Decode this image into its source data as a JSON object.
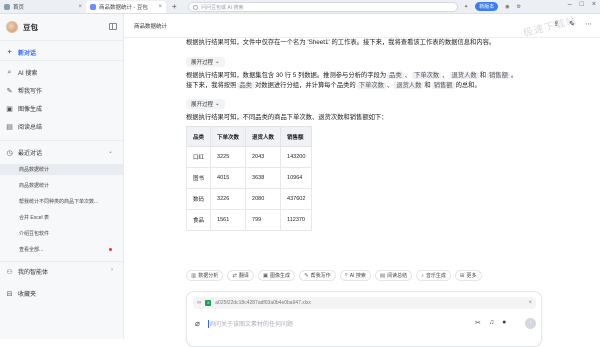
{
  "browser": {
    "tabs": [
      {
        "label": "首页",
        "icon": "home-icon"
      },
      {
        "label": "商品数据统计 - 豆包",
        "icon": "doubao-icon"
      }
    ],
    "address_placeholder": "问问豆包或 AI 搜索",
    "sys_pill": "新版本"
  },
  "sidebar": {
    "brand": "豆包",
    "items": [
      {
        "label": "新对话",
        "icon": "plus-icon"
      },
      {
        "label": "AI 搜索",
        "icon": "search-icon"
      },
      {
        "label": "帮我写作",
        "icon": "pen-icon"
      },
      {
        "label": "图像生成",
        "icon": "image-icon"
      },
      {
        "label": "阅读总结",
        "icon": "book-icon"
      }
    ],
    "recent_header": "最近对话",
    "recent": [
      "商品数据统计",
      "商品数据统计",
      "帮我统计不同种类的商品下单次数...",
      "合并 Excel 表",
      "介绍豆包软件",
      "查看全部..."
    ],
    "agents": "我的智能体",
    "favorites": "收藏夹"
  },
  "main": {
    "title": "商品数据统计",
    "watermark": "极速下载站",
    "p1": "根据执行结果可知，文件中仅存在一个名为 'Sheet1' 的工作表。接下来，我将查看该工作表的数据信息和内容。",
    "expand": "展开过程",
    "p2a": "根据执行结果可知，数据集包含 30 行 5 列数据。推测参与分析的字段为",
    "p2tags": [
      "品类",
      "下单次数",
      "退货人数",
      "销售额"
    ],
    "p2end": "。",
    "p3a": "接下来，我将按照",
    "p3tag": "品类",
    "p3b": "对数据进行分组，并计算每个品类的",
    "p3tags": [
      "下单次数",
      "退货人数",
      "销售额"
    ],
    "p3c": "的总和。",
    "expand2": "展开过程",
    "p4": "根据执行结果可知，不同品类的商品下单次数、退货次数和销售额如下：",
    "table": {
      "headers": [
        "品类",
        "下单次数",
        "退货人数",
        "销售额"
      ],
      "rows": [
        [
          "口红",
          "3225",
          "2043",
          "143200"
        ],
        [
          "图书",
          "4015",
          "3638",
          "10964"
        ],
        [
          "数码",
          "3226",
          "2080",
          "437602"
        ],
        [
          "食品",
          "1561",
          "799",
          "112370"
        ]
      ]
    },
    "tools": [
      {
        "label": "数据分析",
        "icon": "chart-icon"
      },
      {
        "label": "翻译",
        "icon": "translate-icon"
      },
      {
        "label": "图像生成",
        "icon": "image-icon"
      },
      {
        "label": "帮我写作",
        "icon": "pen-icon"
      },
      {
        "label": "AI 搜索",
        "icon": "search-icon"
      },
      {
        "label": "阅读总结",
        "icon": "book-icon"
      },
      {
        "label": "音乐生成",
        "icon": "music-icon"
      },
      {
        "label": "更多",
        "icon": "grid-icon"
      }
    ],
    "file_name": "a025f22dc18c4287adf03a0b4e0ba947.xlsx",
    "input_placeholder": "询问关于该图文素材的任何问题"
  }
}
